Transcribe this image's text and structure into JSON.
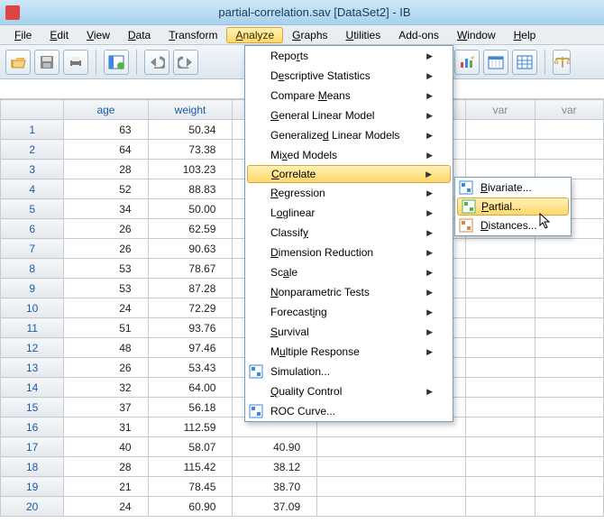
{
  "title": "partial-correlation.sav [DataSet2] - IB",
  "menubar": [
    "File",
    "Edit",
    "View",
    "Data",
    "Transform",
    "Analyze",
    "Graphs",
    "Utilities",
    "Add-ons",
    "Window",
    "Help"
  ],
  "menubar_underline": [
    0,
    0,
    0,
    0,
    0,
    0,
    0,
    0,
    null,
    0,
    0
  ],
  "active_menu_index": 5,
  "columns": [
    "age",
    "weight"
  ],
  "var_cols": [
    "var",
    "var"
  ],
  "rows": [
    {
      "n": 1,
      "age": 63,
      "weight": "50.34"
    },
    {
      "n": 2,
      "age": 64,
      "weight": "73.38"
    },
    {
      "n": 3,
      "age": 28,
      "weight": "103.23"
    },
    {
      "n": 4,
      "age": 52,
      "weight": "88.83"
    },
    {
      "n": 5,
      "age": 34,
      "weight": "50.00"
    },
    {
      "n": 6,
      "age": 26,
      "weight": "62.59"
    },
    {
      "n": 7,
      "age": 26,
      "weight": "90.63"
    },
    {
      "n": 8,
      "age": 53,
      "weight": "78.67"
    },
    {
      "n": 9,
      "age": 53,
      "weight": "87.28"
    },
    {
      "n": 10,
      "age": 24,
      "weight": "72.29"
    },
    {
      "n": 11,
      "age": 51,
      "weight": "93.76"
    },
    {
      "n": 12,
      "age": 48,
      "weight": "97.46"
    },
    {
      "n": 13,
      "age": 26,
      "weight": "53.43"
    },
    {
      "n": 14,
      "age": 32,
      "weight": "64.00"
    },
    {
      "n": 15,
      "age": 37,
      "weight": "56.18"
    },
    {
      "n": 16,
      "age": 31,
      "weight": "112.59"
    },
    {
      "n": 17,
      "age": 40,
      "weight": "58.07",
      "c3": "40.90"
    },
    {
      "n": 18,
      "age": 28,
      "weight": "115.42",
      "c3": "38.12"
    },
    {
      "n": 19,
      "age": 21,
      "weight": "78.45",
      "c3": "38.70"
    },
    {
      "n": 20,
      "age": 24,
      "weight": "60.90",
      "c3": "37.09"
    }
  ],
  "analyze_menu": [
    {
      "label": "Reports",
      "u": 4,
      "arrow": true
    },
    {
      "label": "Descriptive Statistics",
      "u": 1,
      "arrow": true
    },
    {
      "label": "Compare Means",
      "u": 8,
      "arrow": true
    },
    {
      "label": "General Linear Model",
      "u": 0,
      "arrow": true
    },
    {
      "label": "Generalized Linear Models",
      "u": 10,
      "arrow": true
    },
    {
      "label": "Mixed Models",
      "u": 2,
      "arrow": true
    },
    {
      "label": "Correlate",
      "u": 0,
      "arrow": true,
      "hi": true
    },
    {
      "label": "Regression",
      "u": 0,
      "arrow": true
    },
    {
      "label": "Loglinear",
      "u": 1,
      "arrow": true
    },
    {
      "label": "Classify",
      "u": 7,
      "arrow": true
    },
    {
      "label": "Dimension Reduction",
      "u": 0,
      "arrow": true
    },
    {
      "label": "Scale",
      "u": 2,
      "arrow": true
    },
    {
      "label": "Nonparametric Tests",
      "u": 0,
      "arrow": true
    },
    {
      "label": "Forecasting",
      "u": 8,
      "arrow": true
    },
    {
      "label": "Survival",
      "u": 0,
      "arrow": true
    },
    {
      "label": "Multiple Response",
      "u": 1,
      "arrow": true
    },
    {
      "label": "Simulation...",
      "u": -1,
      "arrow": false,
      "icon": "sim"
    },
    {
      "label": "Quality Control",
      "u": 0,
      "arrow": true
    },
    {
      "label": "ROC Curve...",
      "u": -1,
      "arrow": false,
      "icon": "roc"
    }
  ],
  "correlate_submenu": [
    {
      "label": "Bivariate...",
      "u": 0,
      "icon": "biv"
    },
    {
      "label": "Partial...",
      "u": 0,
      "icon": "par",
      "hi": true
    },
    {
      "label": "Distances...",
      "u": 0,
      "icon": "dis"
    }
  ]
}
